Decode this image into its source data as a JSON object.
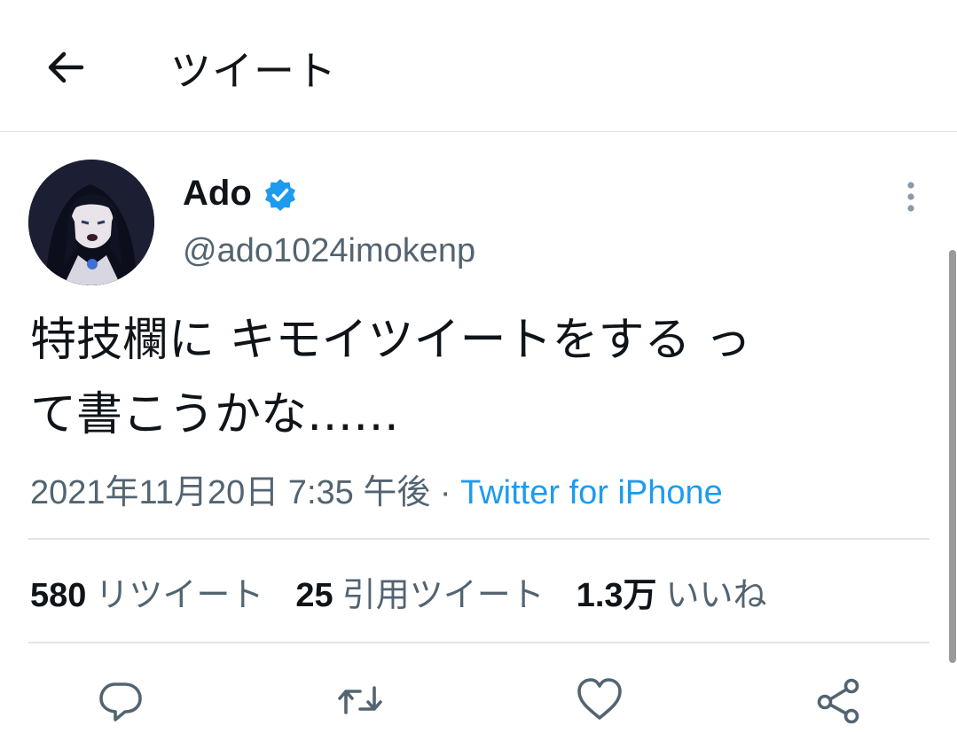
{
  "header": {
    "title": "ツイート",
    "back_icon": "back-arrow-icon"
  },
  "tweet": {
    "author": {
      "name": "Ado",
      "handle": "@ado1024imokenp",
      "verified": true,
      "verified_color": "#1d9bf0"
    },
    "text_lines": [
      "特技欄に キモイツイートをする っ",
      "て書こうかな……"
    ],
    "date": "2021年11月20日 7:35 午後",
    "separator": "·",
    "source": "Twitter for iPhone"
  },
  "stats": [
    {
      "count": "580",
      "label": "リツイート"
    },
    {
      "count": "25",
      "label": "引用ツイート"
    },
    {
      "count": "1.3万",
      "label": "いいね"
    }
  ],
  "actions": [
    "reply-icon",
    "retweet-icon",
    "like-icon",
    "share-icon"
  ],
  "colors": {
    "accent": "#1d9bf0",
    "secondary_text": "#536471",
    "primary_text": "#0f1419"
  }
}
